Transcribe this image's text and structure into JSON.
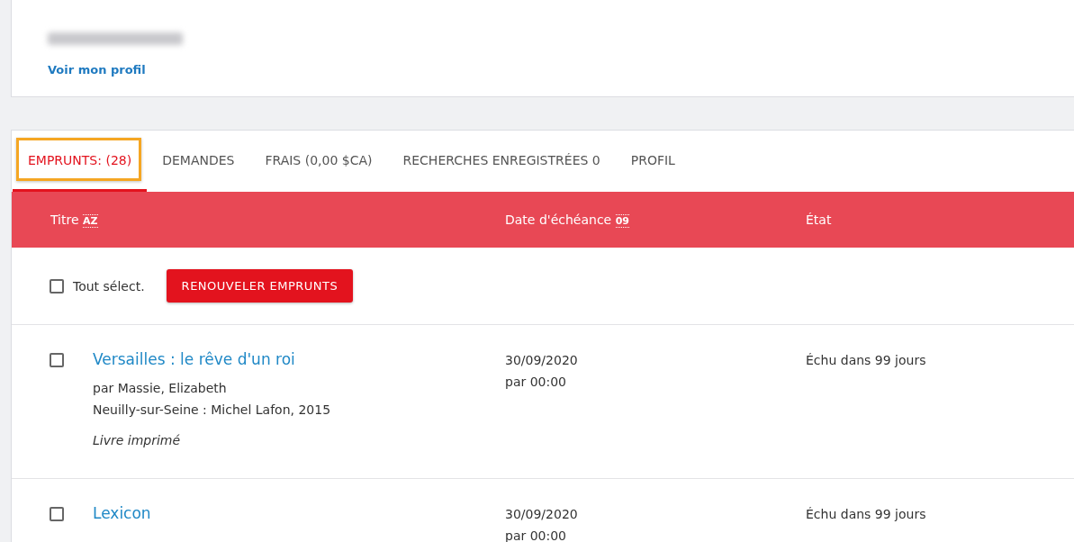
{
  "profile": {
    "link": "Voir mon profil"
  },
  "tabs": [
    {
      "label": "EMPRUNTS: (28)",
      "selected": true,
      "highlighted": true
    },
    {
      "label": "DEMANDES",
      "selected": false,
      "highlighted": false
    },
    {
      "label": "FRAIS (0,00 $CA)",
      "selected": false,
      "highlighted": false
    },
    {
      "label": "RECHERCHES ENREGISTRÉES 0",
      "selected": false,
      "highlighted": false
    },
    {
      "label": "PROFIL",
      "selected": false,
      "highlighted": false
    }
  ],
  "table": {
    "columns": [
      {
        "label": "Titre",
        "sort_glyph": "AZ"
      },
      {
        "label": "Date d'échéance",
        "sort_glyph": "09"
      },
      {
        "label": "État"
      }
    ],
    "select_all": {
      "label": "Tout sélect.",
      "checked": false
    },
    "renew_button": "RENOUVELER EMPRUNTS",
    "rows": [
      {
        "checked": false,
        "title": "Versailles : le rêve d'un roi",
        "author": "par Massie, Elizabeth",
        "publication": "Neuilly-sur-Seine : Michel Lafon, 2015",
        "format": "Livre imprimé",
        "due_date": "30/09/2020",
        "due_time": "par 00:00",
        "status": "Échu dans 99 jours"
      },
      {
        "checked": false,
        "title": "Lexicon",
        "due_date": "30/09/2020",
        "due_time": "par 00:00",
        "status": "Échu dans 99 jours"
      }
    ]
  }
}
